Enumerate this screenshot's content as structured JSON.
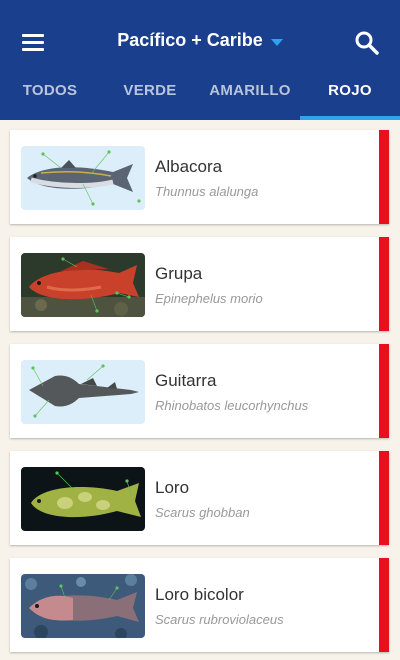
{
  "header": {
    "region": "Pacífico + Caribe",
    "menu_icon": "menu-icon",
    "search_icon": "search-icon",
    "background_color": "#1a3f8c",
    "accent_color": "#2fa3f0"
  },
  "tabs": [
    {
      "label": "TODOS",
      "active": false
    },
    {
      "label": "VERDE",
      "active": false
    },
    {
      "label": "AMARILLO",
      "active": false
    },
    {
      "label": "ROJO",
      "active": true
    }
  ],
  "species": [
    {
      "common_name": "Albacora",
      "scientific_name": "Thunnus alalunga",
      "status_color": "#e8101f"
    },
    {
      "common_name": "Grupa",
      "scientific_name": "Epinephelus morio",
      "status_color": "#e8101f"
    },
    {
      "common_name": "Guitarra",
      "scientific_name": "Rhinobatos leucorhynchus",
      "status_color": "#e8101f"
    },
    {
      "common_name": "Loro",
      "scientific_name": "Scarus ghobban",
      "status_color": "#e8101f"
    },
    {
      "common_name": "Loro bicolor",
      "scientific_name": "Scarus rubroviolaceus",
      "status_color": "#e8101f"
    }
  ]
}
